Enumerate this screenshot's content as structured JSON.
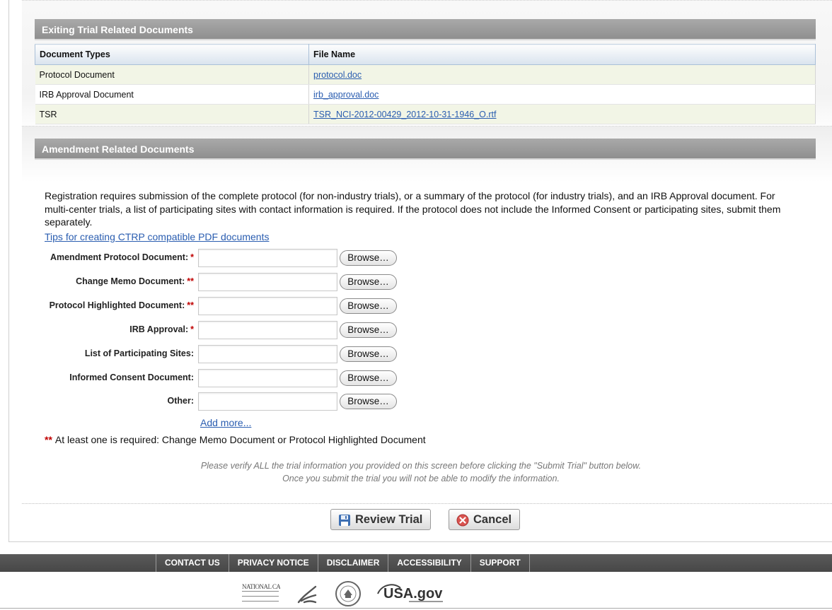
{
  "existing": {
    "title": "Exiting Trial Related Documents",
    "columns": [
      "Document Types",
      "File Name"
    ],
    "rows": [
      {
        "type": "Protocol Document",
        "file": "protocol.doc"
      },
      {
        "type": "IRB Approval Document",
        "file": "irb_approval.doc"
      },
      {
        "type": "TSR",
        "file": "TSR_NCI-2012-00429_2012-10-31-1946_O.rtf"
      }
    ]
  },
  "amendment": {
    "title": "Amendment Related Documents",
    "intro": "Registration requires submission of the complete protocol (for non-industry trials), or a summary of the protocol (for industry trials), and an IRB Approval document. For multi-center trials, a list of participating sites with contact information is required. If the protocol does not include the Informed Consent or participating sites, submit them separately.",
    "tips_link": "Tips for creating CTRP compatible PDF documents",
    "browse_label": "Browse…",
    "fields": [
      {
        "label": "Amendment Protocol Document:",
        "req": "*"
      },
      {
        "label": "Change Memo Document:",
        "req": "**"
      },
      {
        "label": "Protocol Highlighted Document:",
        "req": "**"
      },
      {
        "label": "IRB Approval:",
        "req": "*"
      },
      {
        "label": "List of Participating Sites:",
        "req": ""
      },
      {
        "label": "Informed Consent Document:",
        "req": ""
      },
      {
        "label": "Other:",
        "req": ""
      }
    ],
    "add_more": "Add more...",
    "note_stars": "**",
    "note": "At least one is required: Change Memo Document or Protocol Highlighted Document",
    "verify_line1": "Please verify ALL the trial information you provided on this screen before clicking the \"Submit Trial\" button below.",
    "verify_line2": "Once you submit the trial you will not be able to modify the information."
  },
  "buttons": {
    "review": "Review Trial",
    "cancel": "Cancel"
  },
  "footer": {
    "nav": [
      "CONTACT US",
      "PRIVACY NOTICE",
      "DISCLAIMER",
      "ACCESSIBILITY",
      "SUPPORT"
    ],
    "logos": {
      "nci": "NATIONAL CANCER INSTITUTE",
      "usagov": "USA.gov"
    }
  },
  "colors": {
    "header_bar": "#999999",
    "link": "#2a5db0",
    "required": "#c00000",
    "footer": "#505050"
  }
}
